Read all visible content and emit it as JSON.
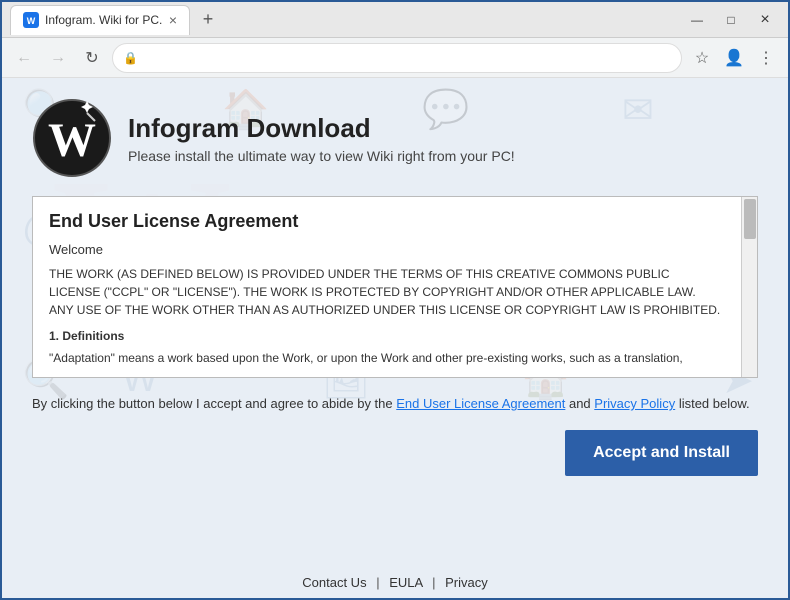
{
  "browser": {
    "tab_label": "Infogram. Wiki for PC.",
    "tab_icon": "W",
    "close_btn": "×",
    "minimize_btn": "—",
    "maximize_btn": "□",
    "new_tab_btn": "+",
    "nav_back": "←",
    "nav_forward": "→",
    "nav_refresh": "↻",
    "lock_icon": "🔒",
    "address_bar_value": "",
    "bookmark_icon": "☆",
    "profile_icon": "👤",
    "menu_icon": "⋮"
  },
  "page": {
    "app_title": "Infogram Download",
    "app_subtitle": "Please install the ultimate way to view Wiki right from your PC!",
    "eula_title": "End User License Agreement",
    "eula_welcome": "Welcome",
    "eula_body": "THE WORK (AS DEFINED BELOW) IS PROVIDED UNDER THE TERMS OF THIS CREATIVE COMMONS PUBLIC LICENSE (\"CCPL\" OR \"LICENSE\"). THE WORK IS PROTECTED BY COPYRIGHT AND/OR OTHER APPLICABLE LAW. ANY USE OF THE WORK OTHER THAN AS AUTHORIZED UNDER THIS LICENSE OR COPYRIGHT LAW IS PROHIBITED.",
    "eula_section_title": "1. Definitions",
    "eula_section_body": "\"Adaptation\" means a work based upon the Work, or upon the Work and other pre-existing works, such as a translation,",
    "agreement_text_1": "By clicking the button below I accept and agree to abide by the ",
    "agreement_link1": "End User License Agreement",
    "agreement_text_2": " and ",
    "agreement_link2": "Privacy Policy",
    "agreement_text_3": " listed below.",
    "accept_btn": "Accept and Install",
    "footer_contact": "Contact Us",
    "footer_eula": "EULA",
    "footer_privacy": "Privacy",
    "footer_sep": "|"
  },
  "colors": {
    "accent_blue": "#2c5fa8",
    "link_blue": "#1a73e8",
    "bg": "#e8eef5"
  }
}
